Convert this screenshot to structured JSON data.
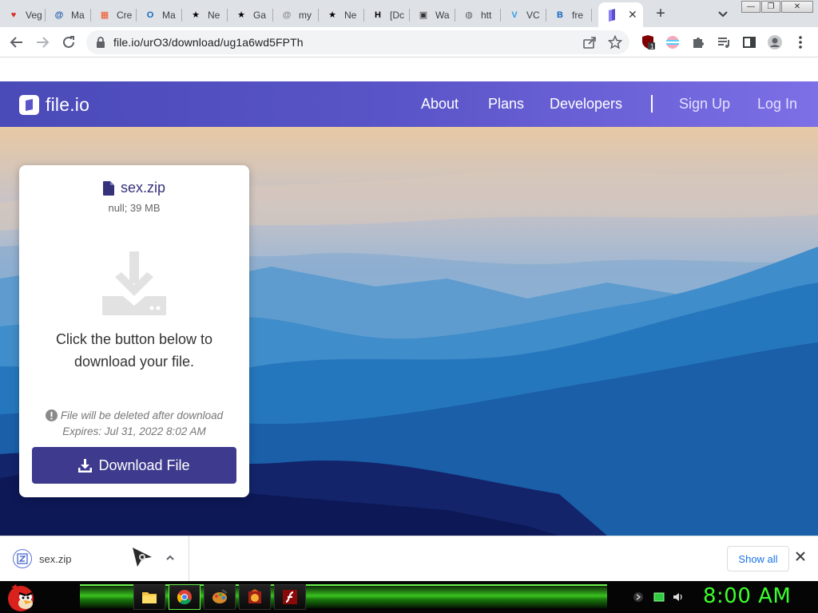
{
  "browser": {
    "tabs": [
      {
        "icon": "heart-icon",
        "title": "Veg",
        "color": "#d93025"
      },
      {
        "icon": "at-mail-icon",
        "title": "Ma",
        "color": "#1a56a8"
      },
      {
        "icon": "windows-icon",
        "title": "Cre",
        "color": "#f25022"
      },
      {
        "icon": "outlook-icon",
        "title": "Ma",
        "color": "#0f6cbd"
      },
      {
        "icon": "star-icon",
        "title": "Ne",
        "color": "#000000"
      },
      {
        "icon": "star-icon",
        "title": "Ga",
        "color": "#000000"
      },
      {
        "icon": "at-sign-icon",
        "title": "my",
        "color": "#888888"
      },
      {
        "icon": "star-icon",
        "title": "Ne",
        "color": "#000000"
      },
      {
        "icon": "h-letter-icon",
        "title": "[Dc",
        "color": "#000000"
      },
      {
        "icon": "clapper-icon",
        "title": "Wa",
        "color": "#333333"
      },
      {
        "icon": "globe-icon",
        "title": "htt",
        "color": "#5f6368"
      },
      {
        "icon": "v-letter-icon",
        "title": "VC",
        "color": "#2e9fe6"
      },
      {
        "icon": "bf-icon",
        "title": "fre",
        "color": "#1565c0"
      }
    ],
    "active_tab": {
      "icon": "fileio-icon",
      "close": "✕"
    },
    "new_tab": "+",
    "url": "file.io/urO3/download/ug1a6wd5FPTh",
    "extension_badge": "1"
  },
  "site": {
    "logo_text": "file.io",
    "nav": {
      "about": "About",
      "plans": "Plans",
      "developers": "Developers",
      "sign_up": "Sign Up",
      "log_in": "Log In"
    },
    "accent": "#3e3a8e"
  },
  "card": {
    "file_name": "sex.zip",
    "file_meta": "null; 39 MB",
    "instructions": "Click the button below to download your file.",
    "warning": "File will be deleted after download",
    "expires": "Expires: Jul 31, 2022 8:02 AM",
    "download_label": "Download File"
  },
  "download_shelf": {
    "file": "sex.zip",
    "show_all": "Show all"
  },
  "taskbar": {
    "clock": "8:00 AM",
    "apps": [
      "file-explorer-icon",
      "chrome-icon",
      "paint-icon",
      "game-icon",
      "flash-icon"
    ]
  }
}
